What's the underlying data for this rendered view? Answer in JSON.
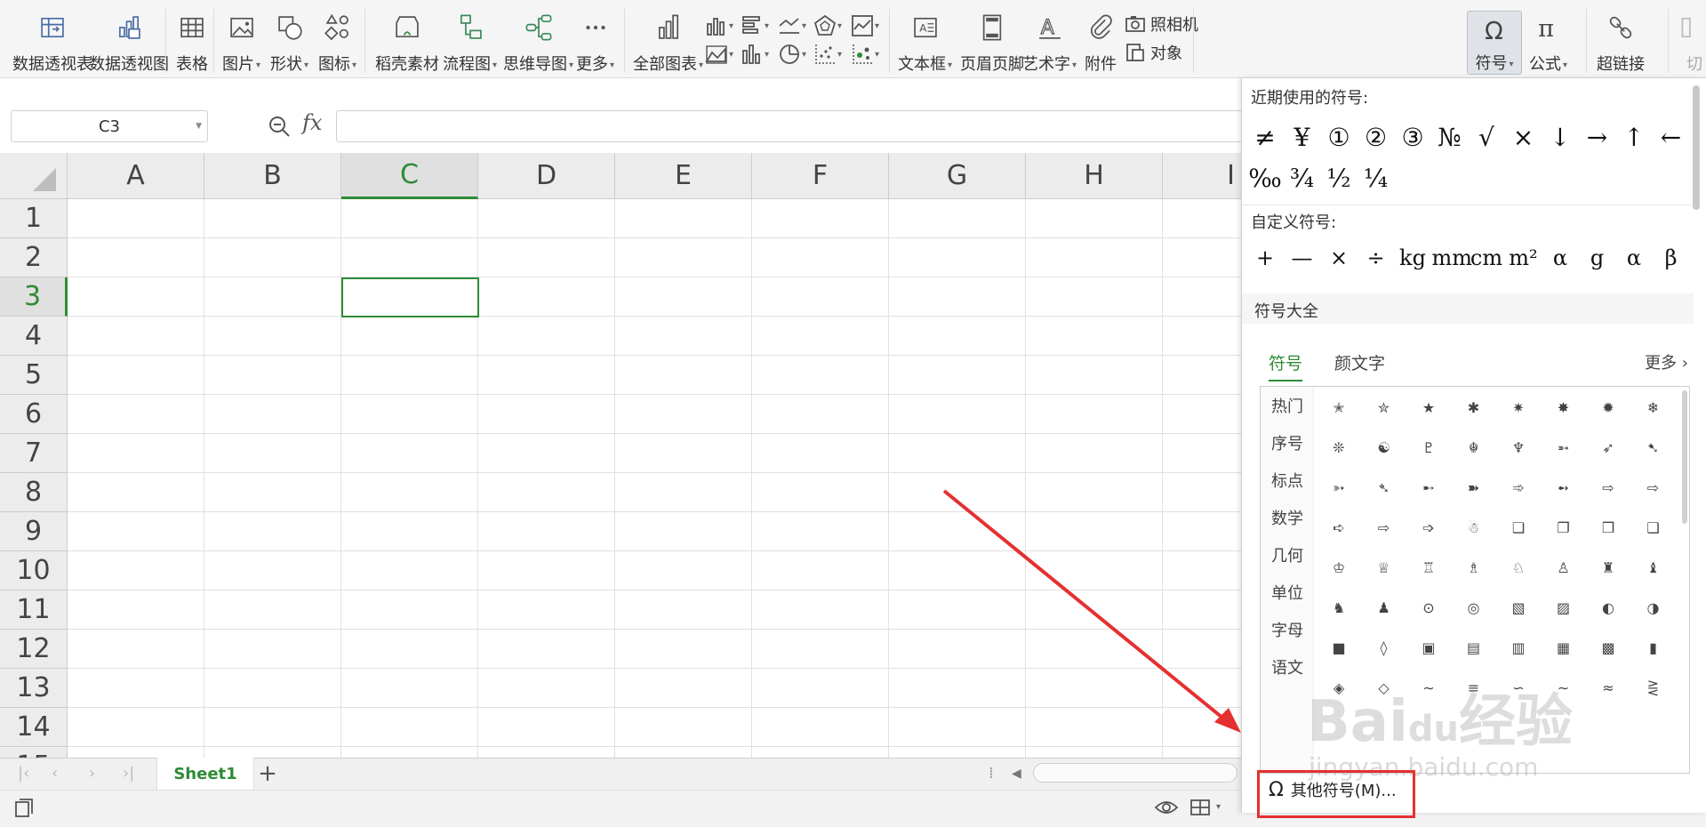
{
  "ribbon": {
    "pivot_table": "数据透视表",
    "pivot_chart": "数据透视图",
    "table": "表格",
    "picture": "图片",
    "shape": "形状",
    "icon": "图标",
    "daoke": "稻壳素材",
    "flowchart": "流程图",
    "mindmap": "思维导图",
    "more": "更多",
    "all_charts": "全部图表",
    "textbox": "文本框",
    "header_footer": "页眉页脚",
    "wordart": "艺术字",
    "attachment": "附件",
    "camera": "照相机",
    "object": "对象",
    "symbol": "符号",
    "formula": "公式",
    "hyperlink": "超链接",
    "cut_partial": "切"
  },
  "formula_bar": {
    "name_box": "C3",
    "fx": "fx"
  },
  "grid": {
    "columns": [
      "A",
      "B",
      "C",
      "D",
      "E",
      "F",
      "G",
      "H",
      "I"
    ],
    "rows": [
      "1",
      "2",
      "3",
      "4",
      "5",
      "6",
      "7",
      "8",
      "9",
      "10",
      "11",
      "12",
      "13",
      "14",
      "15"
    ],
    "selected_cell": "C3"
  },
  "sheets": {
    "tab": "Sheet1",
    "add": "+"
  },
  "symbol_panel": {
    "recent_title": "近期使用的符号:",
    "recent_row1": [
      "≠",
      "¥",
      "①",
      "②",
      "③",
      "№",
      "√",
      "×",
      "↓",
      "→",
      "↑",
      "←"
    ],
    "recent_row2": [
      "‰",
      "¾",
      "½",
      "¼"
    ],
    "custom_title": "自定义符号:",
    "custom_row": [
      "+",
      "—",
      "×",
      "÷",
      "kg",
      "mm",
      "cm",
      "m²",
      "α",
      "g",
      "α",
      "β"
    ],
    "all_title": "符号大全",
    "tab_symbol": "符号",
    "tab_kaomoji": "颜文字",
    "more": "更多",
    "categories": [
      "热门",
      "序号",
      "标点",
      "数学",
      "几何",
      "单位",
      "字母",
      "语文"
    ],
    "grid_symbols": [
      [
        "✭",
        "✮",
        "★",
        "✱",
        "✷",
        "✸",
        "✹",
        "❄"
      ],
      [
        "❊",
        "☯",
        "♇",
        "☬",
        "♆",
        "➵",
        "➶",
        "➷"
      ],
      [
        "➳",
        "➴",
        "➸",
        "➽",
        "➾",
        "➻",
        "⇨",
        "⇨"
      ],
      [
        "➪",
        "⇨",
        "➩",
        "☃",
        "❏",
        "❐",
        "❒",
        "❑"
      ],
      [
        "♔",
        "♕",
        "♖",
        "♗",
        "♘",
        "♙",
        "♜",
        "♝"
      ],
      [
        "♞",
        "♟",
        "⊙",
        "◎",
        "▧",
        "▨",
        "◐",
        "◑"
      ],
      [
        "■",
        "◊",
        "▣",
        "▤",
        "▥",
        "▦",
        "▩",
        "▮"
      ],
      [
        "◈",
        "◇",
        "∼",
        "≡",
        "∽",
        "∼",
        "≈",
        "⋛"
      ]
    ],
    "other_symbols": "其他符号(M)..."
  },
  "watermark": {
    "brand": "Bai",
    "brand2": "du",
    "brand3": "经验",
    "url": "jingyan.baidu.com"
  },
  "colors": {
    "accent": "#2e8b35",
    "highlight_box": "#e53030",
    "arrow": "#e53030"
  }
}
